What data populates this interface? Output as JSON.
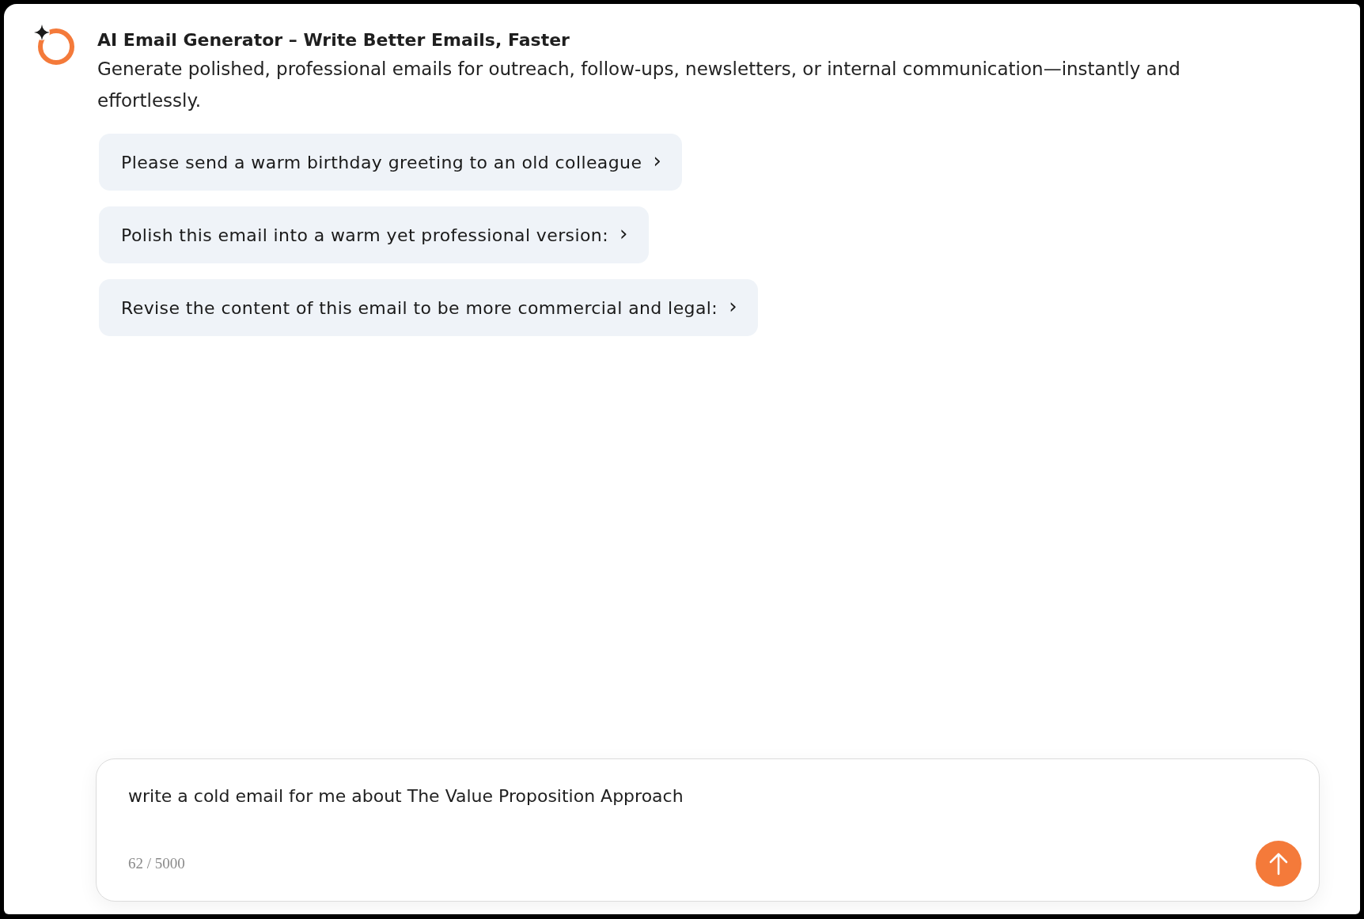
{
  "header": {
    "title": "AI Email Generator – Write Better Emails, Faster",
    "description": "Generate polished, professional emails for outreach, follow-ups, newsletters, or internal communication—instantly and effortlessly."
  },
  "suggestions": [
    {
      "label": "Please send a warm birthday greeting to an old colleague",
      "arrow": "›"
    },
    {
      "label": "Polish this email into a warm yet professional version:",
      "arrow": "›"
    },
    {
      "label": "Revise the content of this email to be more commercial and legal:",
      "arrow": "›"
    }
  ],
  "composer": {
    "value": "write a cold email for me about The Value Proposition Approach",
    "counter": "62 / 5000"
  }
}
